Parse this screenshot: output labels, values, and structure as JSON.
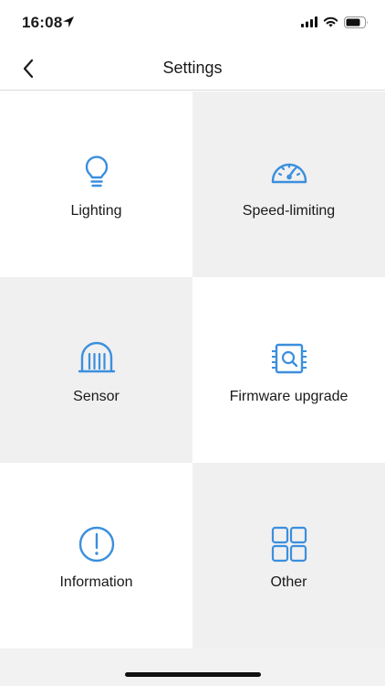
{
  "status_bar": {
    "time": "16:08",
    "icons": [
      "location-arrow-icon",
      "signal-icon",
      "wifi-icon",
      "battery-icon"
    ]
  },
  "nav": {
    "back_icon": "chevron-left-icon",
    "title": "Settings"
  },
  "theme": {
    "accent": "#3b8fde",
    "tile_gray": "#f0f0f0",
    "tile_white": "#ffffff"
  },
  "tiles": [
    {
      "label": "Lighting",
      "icon": "lightbulb-icon"
    },
    {
      "label": "Speed-limiting",
      "icon": "speedometer-icon"
    },
    {
      "label": "Sensor",
      "icon": "sensor-icon"
    },
    {
      "label": "Firmware upgrade",
      "icon": "chip-icon"
    },
    {
      "label": "Information",
      "icon": "info-icon"
    },
    {
      "label": "Other",
      "icon": "grid-icon"
    }
  ]
}
